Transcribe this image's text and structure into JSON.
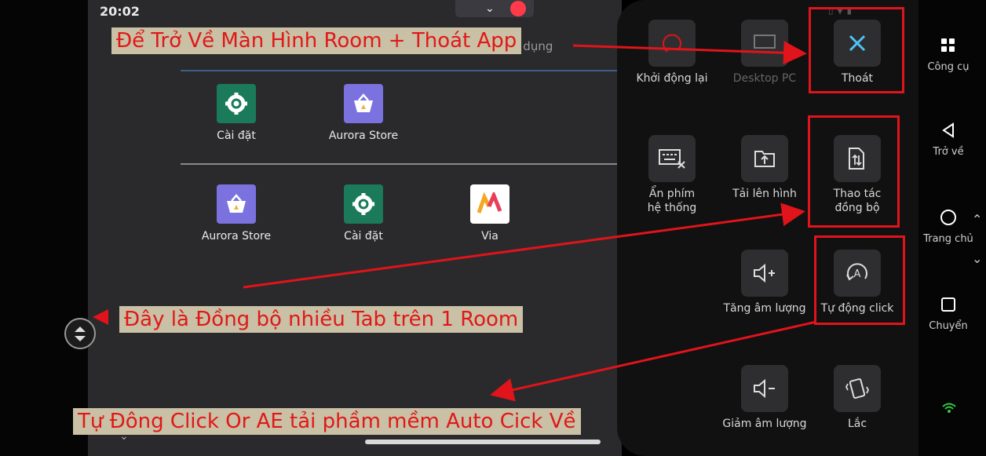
{
  "status_bar": {
    "time": "20:02"
  },
  "search_placeholder": "Tìm kiếm ứng dụng",
  "home_apps_row1": [
    {
      "label": "Cài đặt",
      "icon": "settings-gear-icon"
    },
    {
      "label": "Aurora Store",
      "icon": "aurora-store-icon"
    }
  ],
  "home_apps_row2": [
    {
      "label": "Aurora Store",
      "icon": "aurora-store-icon"
    },
    {
      "label": "Cài đặt",
      "icon": "settings-gear-icon"
    },
    {
      "label": "Via",
      "icon": "via-browser-icon"
    }
  ],
  "tools": [
    {
      "label": "Khởi động lại",
      "icon": "restart-icon"
    },
    {
      "label": "Desktop PC",
      "icon": "desktop-icon",
      "disabled": true
    },
    {
      "label": "Thoát",
      "icon": "close-icon"
    },
    {
      "label": "Ẩn phím hệ thống",
      "line1": "Ẩn phím",
      "line2": "hệ thống",
      "icon": "hide-keyboard-icon"
    },
    {
      "label": "Tải lên hình",
      "icon": "upload-image-icon"
    },
    {
      "label": "Thao tác đồng bộ",
      "line1": "Thao tác",
      "line2": "đồng bộ",
      "icon": "sync-operation-icon"
    },
    {
      "label": "Tăng âm lượng",
      "icon": "volume-up-icon"
    },
    {
      "label": "Tự động click",
      "icon": "auto-click-icon"
    },
    {
      "label": "Giảm âm lượng",
      "icon": "volume-down-icon"
    },
    {
      "label": "Lắc",
      "icon": "shake-icon"
    }
  ],
  "nav": [
    {
      "label": "Công cụ",
      "icon": "grid-icon"
    },
    {
      "label": "Trở về",
      "icon": "back-triangle-icon"
    },
    {
      "label": "Trang chủ",
      "icon": "home-circle-icon"
    },
    {
      "label": "Chuyển",
      "icon": "square-switch-icon"
    }
  ],
  "annotations": {
    "exit_caption": "Để Trở Về Màn Hình Room + Thoát App",
    "sync_caption": "Đây là Đồng bộ nhiều Tab trên 1 Room",
    "autoclick_caption": "Tự Đông Click Or AE tải phầm mềm Auto Cick Về"
  },
  "colors": {
    "annotation_red": "#e0141a",
    "caption_bg": "#c9c0a5",
    "panel_bg": "#111111"
  }
}
